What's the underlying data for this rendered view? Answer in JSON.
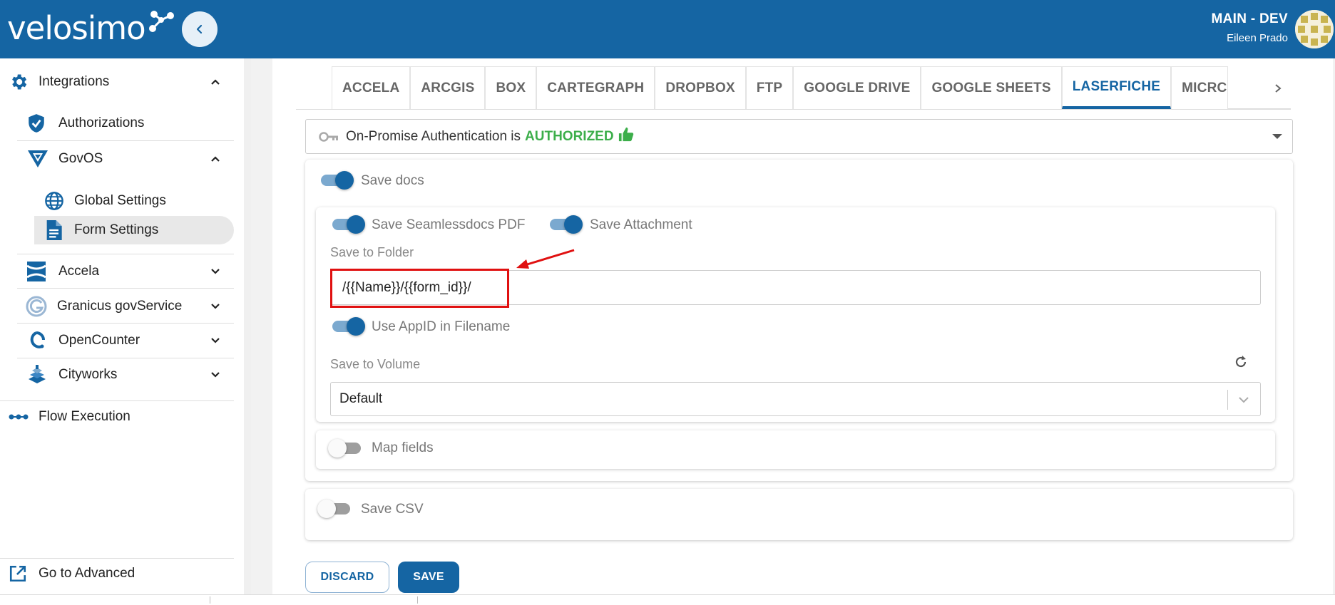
{
  "brand": {
    "name": "velosimo",
    "color": "#1565a3"
  },
  "header": {
    "env_name": "MAIN - DEV",
    "user_name": "Eileen Prado"
  },
  "sidebar": {
    "integrations_label": "Integrations",
    "authorizations_label": "Authorizations",
    "govos_label": "GovOS",
    "global_settings_label": "Global Settings",
    "form_settings_label": "Form Settings",
    "accela_label": "Accela",
    "granicus_label": "Granicus govService",
    "opencounter_label": "OpenCounter",
    "cityworks_label": "Cityworks",
    "flow_execution_label": "Flow Execution",
    "go_advanced_label": "Go to Advanced"
  },
  "tabs": [
    {
      "label": "ACCELA",
      "active": false
    },
    {
      "label": "ARCGIS",
      "active": false
    },
    {
      "label": "BOX",
      "active": false
    },
    {
      "label": "CARTEGRAPH",
      "active": false
    },
    {
      "label": "DROPBOX",
      "active": false
    },
    {
      "label": "FTP",
      "active": false
    },
    {
      "label": "GOOGLE DRIVE",
      "active": false
    },
    {
      "label": "GOOGLE SHEETS",
      "active": false
    },
    {
      "label": "LASERFICHE",
      "active": true
    },
    {
      "label": "MICRC",
      "active": false
    }
  ],
  "auth": {
    "text": "On-Promise Authentication is",
    "status": "AUTHORIZED",
    "status_color": "#3cae4a"
  },
  "form": {
    "save_docs": {
      "label": "Save docs",
      "on": true
    },
    "save_pdf": {
      "label": "Save Seamlessdocs PDF",
      "on": true
    },
    "save_attachment": {
      "label": "Save Attachment",
      "on": true
    },
    "save_to_folder_label": "Save to Folder",
    "save_to_folder_value": "/{{Name}}/{{form_id}}/",
    "use_appid": {
      "label": "Use AppID in Filename",
      "on": true
    },
    "save_to_volume_label": "Save to Volume",
    "volume_value": "Default",
    "map_fields": {
      "label": "Map fields",
      "on": false
    },
    "save_csv": {
      "label": "Save CSV",
      "on": false
    }
  },
  "actions": {
    "discard_label": "DISCARD",
    "save_label": "SAVE"
  }
}
